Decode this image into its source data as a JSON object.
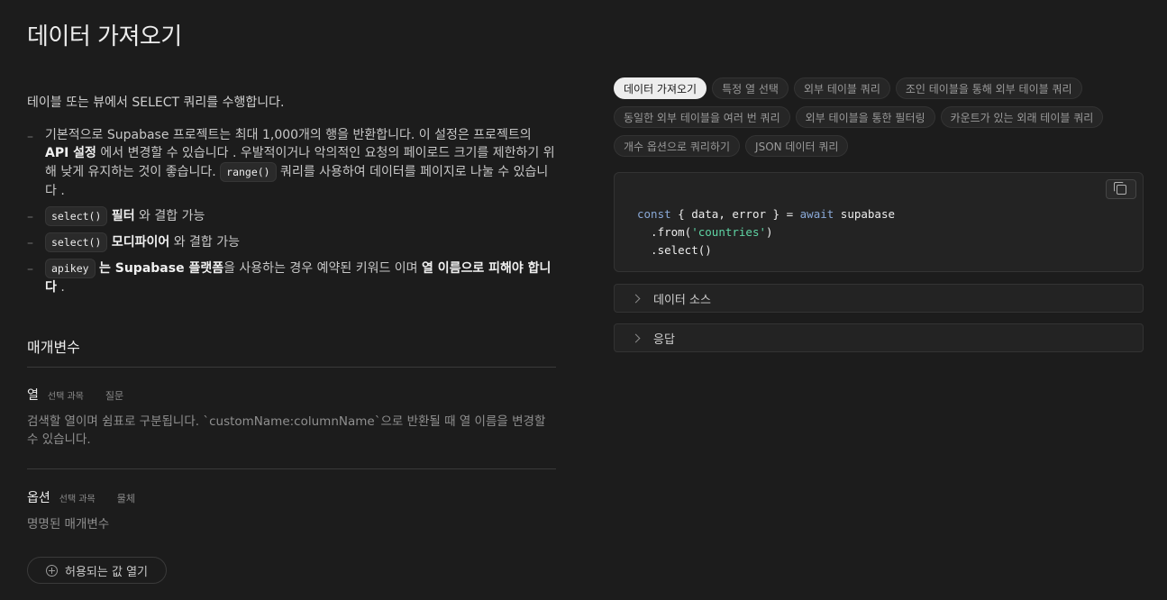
{
  "page": {
    "title": "데이터 가져오기",
    "intro": "테이블 또는 뷰에서 SELECT 쿼리를 수행합니다."
  },
  "notes": {
    "n1_a": "기본적으로 Supabase 프로젝트는 최대 1,000개의 행을 반환합니다. 이 설정은 프로젝트의 ",
    "n1_strong": "API 설정",
    "n1_b": " 에서 변경할 수 있습니다 . 우발적이거나 악의적인 요청의 페이로드 크기를 제한하기 위해 낮게 유지하는 것이 좋습니다. ",
    "n1_code": "range()",
    "n1_c": " 쿼리를 사용하여 데이터를 페이지로 나눌 수 있습니다 .",
    "n2_code": "select()",
    "n2_strong": "필터",
    "n2_rest": " 와 결합 가능",
    "n3_code": "select()",
    "n3_strong": "모디파이어",
    "n3_rest": " 와 결합 가능",
    "n4_code": "apikey",
    "n4_strong1": "는 Supabase 플랫폼",
    "n4_mid": "을 사용하는 경우 예약된 키워드 이며 ",
    "n4_strong2": "열 이름으로 피해야 합니다",
    "n4_end": " ."
  },
  "params": {
    "section_title": "매개변수",
    "p1": {
      "name": "열",
      "meta": "선택 과목",
      "type": "질문",
      "desc": "검색할 열이며 쉼표로 구분됩니다. `customName:columnName`으로 반환될 때 열 이름을 변경할 수 있습니다."
    },
    "p2": {
      "name": "옵션",
      "meta": "선택 과목",
      "type": "물체",
      "desc": "명명된 매개변수"
    },
    "expand_label": "허용되는 값 열기"
  },
  "tabs": [
    "데이터 가져오기",
    "특정 열 선택",
    "외부 테이블 쿼리",
    "조인 테이블을 통해 외부 테이블 쿼리",
    "동일한 외부 테이블을 여러 번 쿼리",
    "외부 테이블을 통한 필터링",
    "카운트가 있는 외래 테이블 쿼리",
    "개수 옵션으로 쿼리하기",
    "JSON 데이터 쿼리"
  ],
  "code": {
    "l1_kw1": "const",
    "l1_a": " { data, error } = ",
    "l1_kw2": "await",
    "l1_b": " supabase",
    "l2_a": "  .from(",
    "l2_str": "'countries'",
    "l2_b": ")",
    "l3": "  .select()"
  },
  "accordions": {
    "data_source": "데이터 소스",
    "response": "응답"
  },
  "colors": {
    "background": "#1c1c1c",
    "active_tab": "#ededed",
    "string": "#5fd4a4",
    "keyword": "#8aa9d8"
  }
}
